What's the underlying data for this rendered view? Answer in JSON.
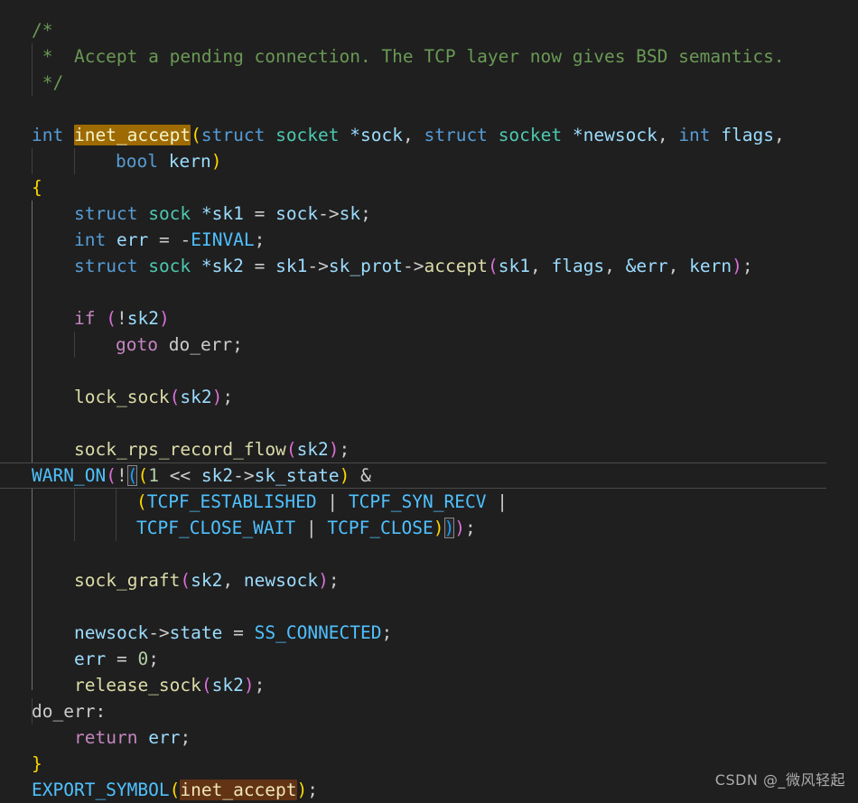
{
  "editor": {
    "language": "c",
    "theme_background": "#1f1f1f",
    "default_text_color": "#cccccc",
    "current_line_number_visible": false,
    "colors": {
      "comment": "#6a9955",
      "keyword": "#569cd6",
      "control_keyword": "#c586c0",
      "type": "#4ec9b0",
      "variable": "#9cdcfe",
      "function": "#dcdcaa",
      "constant": "#4fc1ff",
      "number": "#b5cea8",
      "bracket_level_1": "#ffd700",
      "bracket_level_2": "#da70d6",
      "bracket_level_3": "#179fff",
      "search_match_active": "#9e6a03",
      "search_match": "#623315",
      "indent_guide": "#404040",
      "indent_guide_active": "#707070"
    }
  },
  "code": {
    "l01_comment_open": "/*",
    "l02_comment_star": " *",
    "l02_comment_text": "  Accept a pending connection. The TCP layer now gives BSD semantics.",
    "l03_comment_close": " */",
    "l05_kw_int": "int",
    "l05_fn_name": "inet_accept",
    "l05_paren_open": "(",
    "l05_kw_struct_a": "struct",
    "l05_type_socket_a": "socket",
    "l05_star_sock": "*sock",
    "l05_comma_a": ",",
    "l05_kw_struct_b": "struct",
    "l05_type_socket_b": "socket",
    "l05_star_newsock": "*newsock",
    "l05_comma_b": ",",
    "l05_kw_int_b": "int",
    "l05_var_flags": "flags",
    "l05_comma_c": ",",
    "l06_kw_bool": "bool",
    "l06_var_kern": "kern",
    "l06_paren_close": ")",
    "l07_brace_open": "{",
    "l08_kw_struct": "struct",
    "l08_type_sock": "sock",
    "l08_var_sk1": "*sk1",
    "l08_eq": "=",
    "l08_var_sock": "sock",
    "l08_arrow": "->",
    "l08_var_sk": "sk",
    "l08_semi": ";",
    "l09_kw_int": "int",
    "l09_var_err": "err",
    "l09_eq": "=",
    "l09_minus": "-",
    "l09_const_einval": "EINVAL",
    "l09_semi": ";",
    "l10_kw_struct": "struct",
    "l10_type_sock": "sock",
    "l10_var_sk2": "*sk2",
    "l10_eq": "=",
    "l10_var_sk1": "sk1",
    "l10_arrow_a": "->",
    "l10_var_skprot": "sk_prot",
    "l10_arrow_b": "->",
    "l10_fn_accept": "accept",
    "l10_paren_open": "(",
    "l10_arg_sk1": "sk1",
    "l10_comma_a": ",",
    "l10_arg_flags": "flags",
    "l10_comma_b": ",",
    "l10_arg_err": "&err",
    "l10_comma_c": ",",
    "l10_arg_kern": "kern",
    "l10_paren_close": ")",
    "l10_semi": ";",
    "l12_kw_if": "if",
    "l12_paren_open": "(",
    "l12_not": "!",
    "l12_var_sk2": "sk2",
    "l12_paren_close": ")",
    "l13_kw_goto": "goto",
    "l13_label": "do_err",
    "l13_semi": ";",
    "l15_fn_locksock": "lock_sock",
    "l15_paren_open": "(",
    "l15_arg_sk2": "sk2",
    "l15_paren_close": ")",
    "l15_semi": ";",
    "l17_fn_rps": "sock_rps_record_flow",
    "l17_paren_open": "(",
    "l17_arg_sk2": "sk2",
    "l17_paren_close": ")",
    "l17_semi": ";",
    "l18_fn_warnon": "WARN_ON",
    "l18_paren_open": "(",
    "l18_not": "!",
    "l18_paren_b": "(",
    "l18_paren_c": "(",
    "l18_num_1": "1",
    "l18_shift": "<<",
    "l18_var_sk2": "sk2",
    "l18_arrow": "->",
    "l18_var_skstate": "sk_state",
    "l18_paren_close_c": ")",
    "l18_amp": "&",
    "l19_paren_open": "(",
    "l19_const_established": "TCPF_ESTABLISHED",
    "l19_pipe_a": "|",
    "l19_const_synrecv": "TCPF_SYN_RECV",
    "l19_pipe_b": "|",
    "l20_const_closewait": "TCPF_CLOSE_WAIT",
    "l20_pipe": "|",
    "l20_const_close": "TCPF_CLOSE",
    "l20_paren_close_d": ")",
    "l20_paren_close_b": ")",
    "l20_paren_close_a": ")",
    "l20_semi": ";",
    "l22_fn_sockgraft": "sock_graft",
    "l22_paren_open": "(",
    "l22_arg_sk2": "sk2",
    "l22_comma": ",",
    "l22_arg_newsock": "newsock",
    "l22_paren_close": ")",
    "l22_semi": ";",
    "l24_var_newsock": "newsock",
    "l24_arrow": "->",
    "l24_var_state": "state",
    "l24_eq": "=",
    "l24_const_ssconnected": "SS_CONNECTED",
    "l24_semi": ";",
    "l25_var_err": "err",
    "l25_eq": "=",
    "l25_num_0": "0",
    "l25_semi": ";",
    "l26_fn_release": "release_sock",
    "l26_paren_open": "(",
    "l26_arg_sk2": "sk2",
    "l26_paren_close": ")",
    "l26_semi": ";",
    "l27_label": "do_err:",
    "l28_kw_return": "return",
    "l28_var_err": "err",
    "l28_semi": ";",
    "l29_brace_close": "}",
    "l30_fn_export": "EXPORT_SYMBOL",
    "l30_paren_open": "(",
    "l30_match": "inet_accept",
    "l30_paren_close": ")",
    "l30_semi": ";"
  },
  "watermark": {
    "text": "CSDN @_微风轻起"
  }
}
